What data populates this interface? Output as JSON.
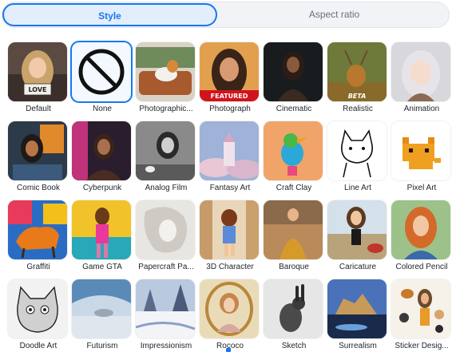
{
  "tabs": {
    "style": "Style",
    "aspect_ratio": "Aspect ratio"
  },
  "accent_color": "#1877f2",
  "styles": [
    {
      "label": "Default",
      "icon": "girl-with-love-sign-image",
      "badge": "LOVE"
    },
    {
      "label": "None",
      "icon": "no-symbol-icon",
      "selected": true
    },
    {
      "label": "Photographic...",
      "icon": "dog-on-sofa-image"
    },
    {
      "label": "Photograph",
      "icon": "woman-portrait-image",
      "badge": "FEATURED"
    },
    {
      "label": "Cinematic",
      "icon": "dark-woman-image"
    },
    {
      "label": "Realistic",
      "icon": "deer-image",
      "badge": "BETA"
    },
    {
      "label": "Animation",
      "icon": "anime-girl-image"
    },
    {
      "label": "Comic Book",
      "icon": "comic-woman-image"
    },
    {
      "label": "Cyberpunk",
      "icon": "cyberpunk-man-image"
    },
    {
      "label": "Analog Film",
      "icon": "bw-woman-image"
    },
    {
      "label": "Fantasy Art",
      "icon": "fantasy-castle-image"
    },
    {
      "label": "Craft Clay",
      "icon": "clay-bird-image"
    },
    {
      "label": "Line Art",
      "icon": "line-cat-image"
    },
    {
      "label": "Pixel Art",
      "icon": "pixel-cat-image"
    },
    {
      "label": "Graffiti",
      "icon": "graffiti-horse-image"
    },
    {
      "label": "Game GTA",
      "icon": "gta-woman-image"
    },
    {
      "label": "Papercraft Pa...",
      "icon": "paper-woman-image"
    },
    {
      "label": "3D Character",
      "icon": "3d-girl-image"
    },
    {
      "label": "Baroque",
      "icon": "baroque-woman-image"
    },
    {
      "label": "Caricature",
      "icon": "caricature-woman-image"
    },
    {
      "label": "Colored Pencil",
      "icon": "pencil-woman-image"
    },
    {
      "label": "Doodle Art",
      "icon": "doodle-cat-image"
    },
    {
      "label": "Futurism",
      "icon": "futuristic-room-image"
    },
    {
      "label": "Impressionism",
      "icon": "snow-landscape-image"
    },
    {
      "label": "Rococo",
      "icon": "rococo-portrait-image"
    },
    {
      "label": "Sketch",
      "icon": "rabbit-sketch-image"
    },
    {
      "label": "Surrealism",
      "icon": "surreal-landscape-image"
    },
    {
      "label": "Sticker Desig...",
      "icon": "sticker-sheet-image"
    }
  ]
}
